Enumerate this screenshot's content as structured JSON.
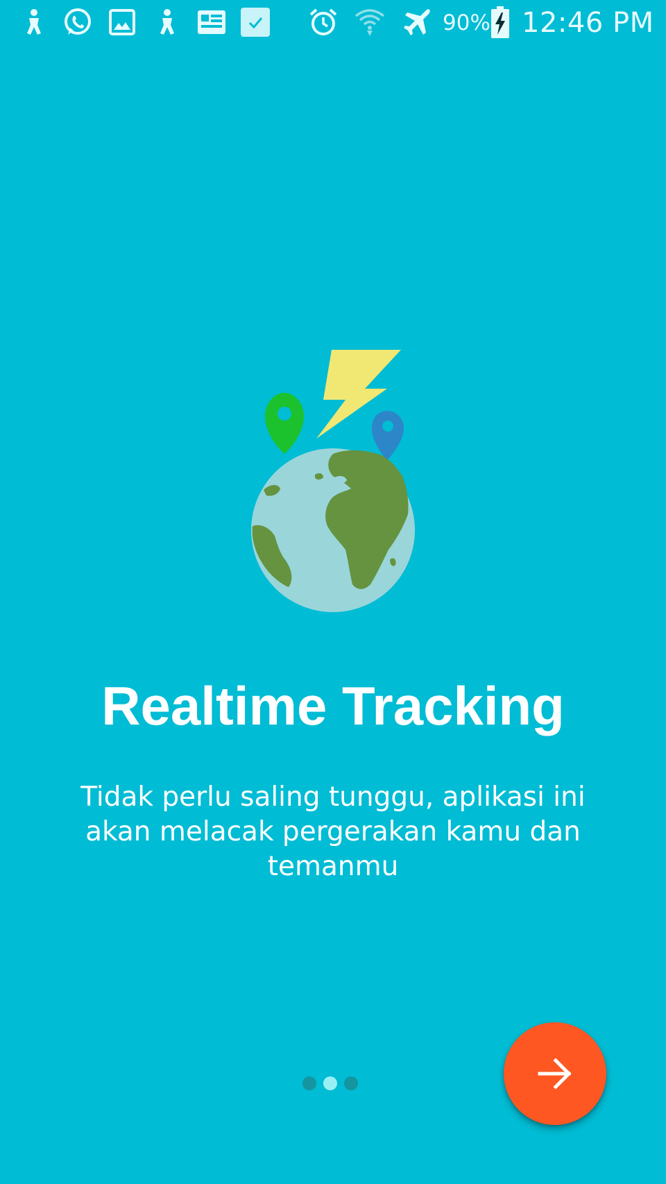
{
  "status_bar": {
    "notification_icons": [
      "accessibility-icon",
      "whatsapp-icon",
      "gallery-icon",
      "accessibility-icon",
      "news-icon",
      "checkbox-icon"
    ],
    "system_icons": [
      "alarm-icon",
      "wifi-icon",
      "airplane-mode-icon",
      "battery-charging-icon"
    ],
    "battery": "90%",
    "time": "12:46 PM"
  },
  "onboarding": {
    "illustration": "globe-location-pins-lightning-icon",
    "title": "Realtime Tracking",
    "description": "Tidak perlu saling tunggu, aplikasi ini akan melacak pergerakan kamu dan temanmu",
    "pages": {
      "total": 3,
      "current": 2
    },
    "next_button_icon": "arrow-right-icon"
  },
  "colors": {
    "background": "#00BCD4",
    "fab": "#FF5722",
    "globe_ocean": "#9AD5DA",
    "globe_land": "#65933F",
    "pin_green": "#1CC12E",
    "pin_blue": "#2C86C8",
    "lightning": "#F1E773"
  }
}
